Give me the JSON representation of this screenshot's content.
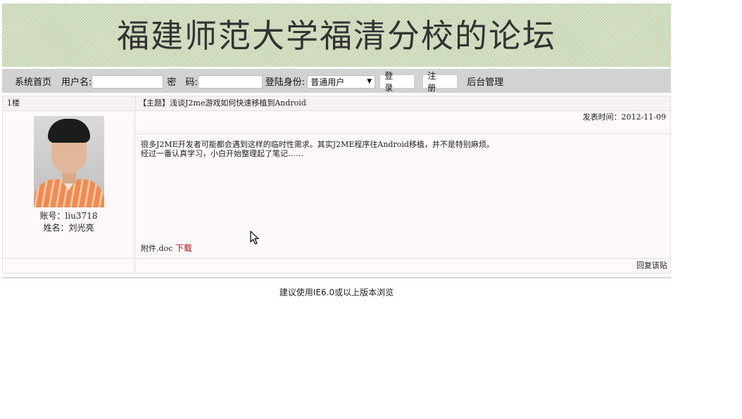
{
  "banner": {
    "title": "福建师范大学福清分校的论坛"
  },
  "nav": {
    "home": "系统首页",
    "username_label": "用户名:",
    "username_value": "",
    "password_label": "密　码:",
    "password_value": "",
    "role_label": "登陆身份:",
    "role_selected": "普通用户",
    "login_button": "登 录",
    "register_button": "注 册",
    "admin": "后台管理"
  },
  "post": {
    "floor": "1楼",
    "subject": "【主题】浅谈J2me游戏如何快速移植到Android",
    "posted_time": "发表时间：2012-11-09",
    "body_line1": "很多J2ME开发者可能都会遇到这样的临时性需求。其实J2ME程序往Android移植，并不是特别麻烦。",
    "body_line2": "经过一番认真学习，小白开始整理起了笔记……",
    "attachment_label": "附件.doc ",
    "download_link": "下载",
    "reply_link": "回复该贴",
    "author": {
      "account": "账号：liu3718",
      "name": "姓名：刘光亮"
    }
  },
  "footer": {
    "note": "建议使用IE6.0或以上版本浏览"
  }
}
